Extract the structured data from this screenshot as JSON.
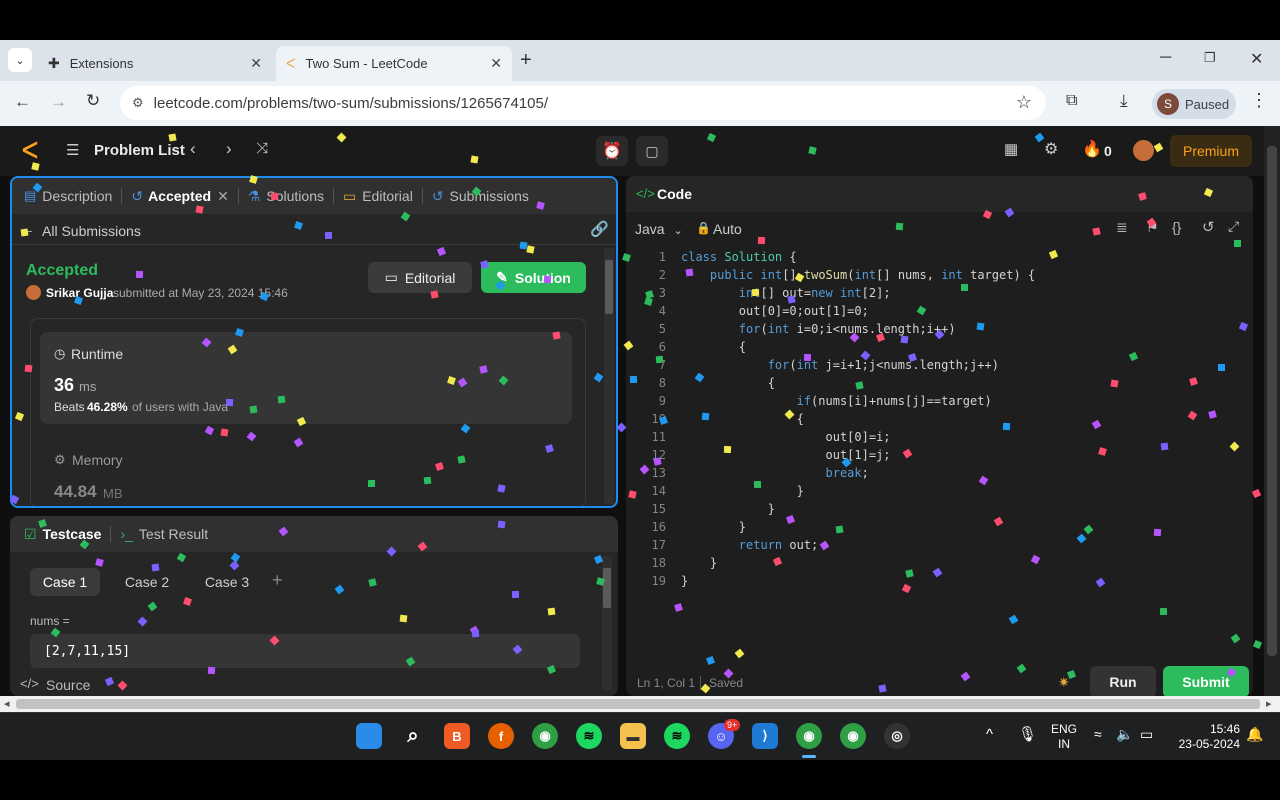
{
  "browser": {
    "tabs": [
      {
        "label": "Extensions",
        "icon": "puzzle-icon"
      },
      {
        "label": "Two Sum - LeetCode",
        "icon": "leetcode-icon"
      }
    ],
    "url": "leetcode.com/problems/two-sum/submissions/1265674105/",
    "profile_initial": "S",
    "profile_status": "Paused"
  },
  "nav": {
    "problem_list": "Problem List",
    "streak_count": "0",
    "premium": "Premium"
  },
  "left_panel": {
    "tabs": [
      "Description",
      "Accepted",
      "Solutions",
      "Editorial",
      "Submissions"
    ],
    "back_label": "All Submissions",
    "status": "Accepted",
    "user": "Srikar Gujja",
    "submitted_text": "submitted at May 23, 2024 15:46",
    "editorial_btn": "Editorial",
    "solution_btn": "Solution",
    "runtime": {
      "title": "Runtime",
      "value": "36",
      "unit": "ms",
      "beats_prefix": "Beats",
      "beats_pct": "46.28%",
      "beats_suffix": "of users with Java"
    },
    "memory": {
      "title": "Memory",
      "value": "44.84",
      "unit": "MB"
    }
  },
  "test_panel": {
    "tabs": [
      "Testcase",
      "Test Result"
    ],
    "cases": [
      "Case 1",
      "Case 2",
      "Case 3"
    ],
    "add": "+",
    "input_label": "nums =",
    "input_value": "[2,7,11,15]",
    "source_label": "Source"
  },
  "editor": {
    "title": "Code",
    "language": "Java",
    "mode": "Auto",
    "status": "Ln 1, Col 1",
    "saved": "Saved",
    "run": "Run",
    "submit": "Submit",
    "lines": [
      "class Solution {",
      "    public int[] twoSum(int[] nums, int target) {",
      "        int[] out=new int[2];",
      "        out[0]=0;out[1]=0;",
      "        for(int i=0;i<nums.length;i++)",
      "        {",
      "            for(int j=i+1;j<nums.length;j++)",
      "            {",
      "                if(nums[i]+nums[j]==target)",
      "                {",
      "                    out[0]=i;",
      "                    out[1]=j;",
      "                    break;",
      "                }",
      "            }",
      "        }",
      "        return out;",
      "    }",
      "}"
    ]
  },
  "taskbar": {
    "lang_top": "ENG",
    "lang_bottom": "IN",
    "time": "15:46",
    "date": "23-05-2024",
    "discord_badge": "9+"
  },
  "colors": {
    "accent_green": "#2cbb5d",
    "premium_orange": "#ffa116",
    "focus_blue": "#1e8bf0"
  }
}
